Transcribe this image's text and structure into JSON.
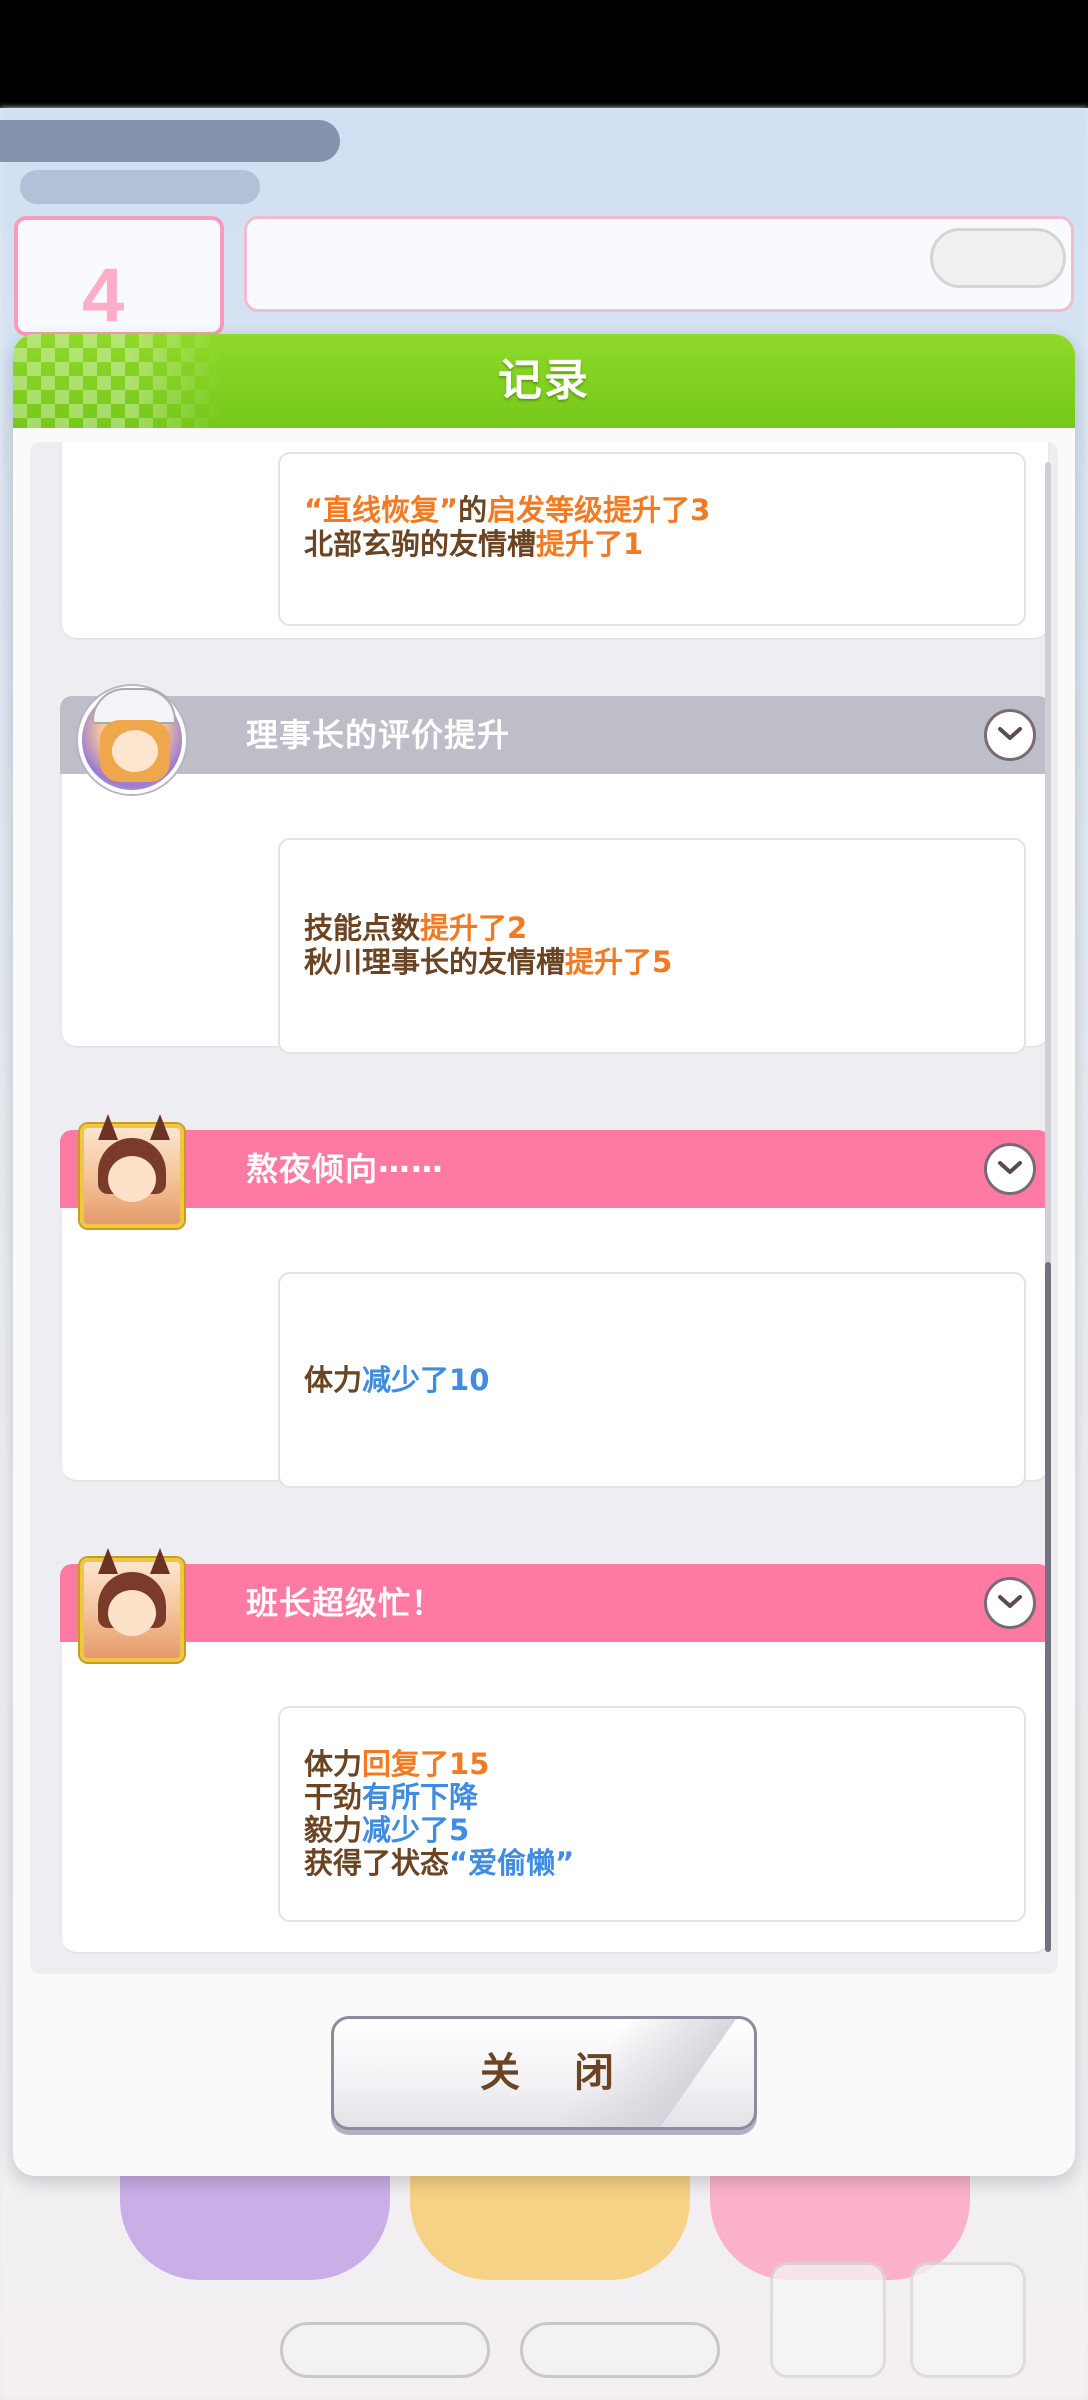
{
  "background": {
    "turn_number": "4"
  },
  "dialog": {
    "title": "记录",
    "close_label": "关 闭"
  },
  "colors": {
    "header_green": "#7ccc1f",
    "gray_header": "#bebec9",
    "pink_header": "#ff7aa3",
    "text_brown": "#6b4423",
    "increase_orange": "#f27a22",
    "decrease_blue": "#3f8ce0"
  },
  "entries": [
    {
      "title": "",
      "header_color": "none",
      "icon": "none",
      "lines": [
        [
          {
            "text": "“直线恢复”",
            "color": "orange"
          },
          {
            "text": "的",
            "color": "brown"
          },
          {
            "text": "启发等级提升了3",
            "color": "orange"
          }
        ],
        [
          {
            "text": "北部玄驹的友情槽",
            "color": "brown"
          },
          {
            "text": "提升了1",
            "color": "orange"
          }
        ]
      ]
    },
    {
      "title": "理事长的评价提升",
      "header_color": "gray",
      "icon": "chairman-avatar-icon",
      "lines": [
        [
          {
            "text": "技能点数",
            "color": "brown"
          },
          {
            "text": "提升了2",
            "color": "orange"
          }
        ],
        [
          {
            "text": "秋川理事长的友情槽",
            "color": "brown"
          },
          {
            "text": "提升了5",
            "color": "orange"
          }
        ]
      ]
    },
    {
      "title": "熬夜倾向⋯⋯",
      "header_color": "pink",
      "icon": "horse-girl-avatar-icon",
      "lines": [
        [
          {
            "text": "体力",
            "color": "brown"
          },
          {
            "text": "减少了10",
            "color": "blue"
          }
        ]
      ]
    },
    {
      "title": "班长超级忙！",
      "header_color": "pink",
      "icon": "horse-girl-avatar-icon",
      "lines": [
        [
          {
            "text": "体力",
            "color": "brown"
          },
          {
            "text": "回复了15",
            "color": "orange"
          }
        ],
        [
          {
            "text": "干劲",
            "color": "brown"
          },
          {
            "text": "有所下降",
            "color": "blue"
          }
        ],
        [
          {
            "text": "毅力",
            "color": "brown"
          },
          {
            "text": "减少了5",
            "color": "blue"
          }
        ],
        [
          {
            "text": "获得了状态",
            "color": "brown"
          },
          {
            "text": "“爱偷懒”",
            "color": "blue"
          }
        ]
      ]
    }
  ],
  "scroll": {
    "position_fraction": 1.0
  }
}
